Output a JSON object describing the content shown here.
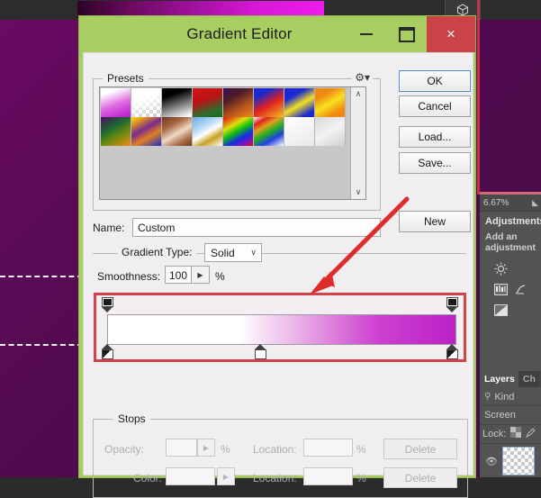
{
  "app": {
    "zoom_level": "6.67%",
    "cube_icon": "3d-cube-icon"
  },
  "dialog": {
    "title": "Gradient Editor",
    "window_controls": {
      "minimize": "minimize-icon",
      "maximize": "maximize-icon",
      "close": "×"
    },
    "presets": {
      "legend": "Presets",
      "gear_icon": "⚙",
      "scroll_up": "∧",
      "scroll_down": "∨",
      "swatches": [
        {
          "name": "white-to-magenta",
          "css": "linear-gradient(160deg,#ffffff 0%,#ffffff 18%,#e06ce0 55%,#c52fd4 85%,#b31fc8 100%)"
        },
        {
          "name": "foreground-to-transparent",
          "css": "linear-gradient(160deg,#ffffff 0%,#ffffff 35%,rgba(255,255,255,0) 100%)"
        },
        {
          "name": "black-to-white",
          "css": "linear-gradient(160deg,#000000 0%,#000000 25%,#ffffff 95%)"
        },
        {
          "name": "red-green",
          "css": "linear-gradient(160deg,#cf1717 0%,#bb1212 40%,#2f6b2f 75%,#156b15 100%)"
        },
        {
          "name": "violet-orange",
          "css": "linear-gradient(150deg,#3a1050 0%,#4a1a2a 30%,#b4541a 65%,#f0891a 100%)"
        },
        {
          "name": "blue-red-yellow",
          "css": "linear-gradient(150deg,#1a2ad0 0%,#1a2ad0 22%,#e02020 55%,#f0c020 100%)"
        },
        {
          "name": "blue-yellow-blue",
          "css": "linear-gradient(150deg,#1a2ad0 0%,#1a2ad0 28%,#f5e020 55%,#1a2ad0 85%,#1a2ad0 100%)"
        },
        {
          "name": "orange-yellow-orange",
          "css": "linear-gradient(150deg,#f08a12 0%,#f08a12 25%,#f7e020 52%,#f08a12 80%,#f08a12 100%)"
        },
        {
          "name": "violet-green-orange",
          "css": "linear-gradient(150deg,#4a1060 0%,#1e6a30 38%,#6a8a10 62%,#f08a12 100%)"
        },
        {
          "name": "yellow-violet-orange-blue",
          "css": "linear-gradient(150deg,#f5e020 0%,#e09020 18%,#7a2a8a 42%,#e08020 65%,#1a2ad0 100%)"
        },
        {
          "name": "copper",
          "css": "linear-gradient(150deg,#6a3a20 0%,#a86a42 30%,#f0d8c8 55%,#a86a42 80%,#6a3a20 100%)"
        },
        {
          "name": "chrome",
          "css": "linear-gradient(150deg,#6aa8e0 0%,#bddcf5 35%,#ffffff 52%,#caa020 72%,#ffffff 100%)"
        },
        {
          "name": "spectrum",
          "css": "linear-gradient(150deg,#e01010 0%,#e07010 15%,#e0e010 30%,#10c010 48%,#1030e0 68%,#8010c0 85%,#e01010 100%)"
        },
        {
          "name": "transparent-rainbow",
          "css": "linear-gradient(150deg,#ffffff 0%,#e02020 18%,#e0a020 34%,#20b020 52%,#2040e0 72%,#ffffff 100%)"
        },
        {
          "name": "transparent-stripes",
          "css": "linear-gradient(150deg,#ffffff 0%,#f4f4f4 50%,#e8e8e8 100%)"
        },
        {
          "name": "checkerboard-transparent",
          "css": "linear-gradient(150deg,#d8d8d8 0%,#f2f2f2 50%,#d0d0d0 100%)"
        }
      ]
    },
    "name": {
      "label": "Name:",
      "value": "Custom",
      "placeholder": ""
    },
    "buttons": {
      "ok": "OK",
      "cancel": "Cancel",
      "load": "Load...",
      "save": "Save...",
      "new": "New"
    },
    "gradient_type": {
      "label": "Gradient Type:",
      "value": "Solid",
      "chevron": "∨"
    },
    "smoothness": {
      "label": "Smoothness:",
      "value": "100",
      "spinner": "▶",
      "unit": "%"
    },
    "gradient_bar": {
      "css": "linear-gradient(90deg,#ffffff 0%,#ffffff 38%,#e8a9e6 56%,#cc3fcf 78%,#bb22c6 100%)",
      "highlight_color": "#d2424a",
      "opacity_stops": [
        {
          "name": "opacity-stop-left",
          "position_pct": 0
        },
        {
          "name": "opacity-stop-right",
          "position_pct": 100
        }
      ],
      "color_stops": [
        {
          "name": "color-stop-left",
          "position_pct": 0
        },
        {
          "name": "color-stop-middle",
          "position_pct": 45
        },
        {
          "name": "color-stop-right",
          "position_pct": 100
        }
      ]
    },
    "stops": {
      "legend": "Stops",
      "opacity_label": "Opacity:",
      "opacity_value": "",
      "opacity_spinner": "▶",
      "opacity_unit": "%",
      "color_label": "Color:",
      "color_value": "",
      "color_spinner": "▶",
      "location_label": "Location:",
      "location_value_1": "",
      "location_value_2": "",
      "location_unit_1": "%",
      "location_unit_2": "%",
      "delete_1": "Delete",
      "delete_2": "Delete"
    }
  },
  "panels": {
    "adjustments": {
      "title": "Adjustments",
      "subtitle": "Add an adjustment",
      "icons": [
        "brightness-icon",
        "levels-icon",
        "curves-icon",
        "exposure-icon",
        "invert-icon"
      ]
    },
    "layers": {
      "tab_layers": "Layers",
      "tab_channels": "Ch",
      "filter_label": "Kind",
      "filter_icon": "search-icon",
      "blend_mode": "Screen",
      "lock_label": "Lock:",
      "lock_icon": "transparent-pixels-icon",
      "eye_icon": "visibility-icon"
    }
  }
}
